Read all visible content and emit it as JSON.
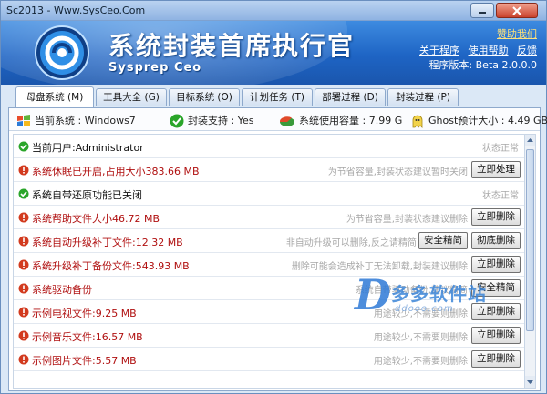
{
  "window": {
    "title": "Sc2013 - Www.SysCeo.Com"
  },
  "header": {
    "app_name": "系统封装首席执行官",
    "app_sub": "Sysprep  Ceo",
    "help_link": "赞助我们",
    "links": [
      "关于程序",
      "使用帮助",
      "反馈"
    ],
    "version": "程序版本: Beta 2.0.0.0"
  },
  "tabs": [
    {
      "label": "母盘系统 (M)"
    },
    {
      "label": "工具大全 (G)"
    },
    {
      "label": "目标系统 (O)"
    },
    {
      "label": "计划任务 (T)"
    },
    {
      "label": "部署过程 (D)"
    },
    {
      "label": "封装过程 (P)"
    }
  ],
  "info": {
    "os": "当前系统 : Windows7",
    "support": "封装支持 : Yes",
    "usage": "系统使用容量 : 7.99 G",
    "ghost": "Ghost预计大小 : 4.49 GB"
  },
  "rows": [
    {
      "status": "ok",
      "label": "当前用户:Administrator",
      "note": "状态正常",
      "buttons": []
    },
    {
      "status": "warn",
      "label": "系统休眠已开启,占用大小383.66 MB",
      "note": "为节省容量,封装状态建议暂时关闭",
      "buttons": [
        "立即处理"
      ]
    },
    {
      "status": "ok",
      "label": "系统自带还原功能已关闭",
      "note": "状态正常",
      "buttons": []
    },
    {
      "status": "warn",
      "label": "系统帮助文件大小46.72 MB",
      "note": "为节省容量,封装状态建议删除",
      "buttons": [
        "立即删除"
      ]
    },
    {
      "status": "warn",
      "label": "系统自动升级补丁文件:12.32 MB",
      "note": "非自动升级可以删除,反之请精简",
      "buttons": [
        "安全精简",
        "彻底删除"
      ]
    },
    {
      "status": "warn",
      "label": "系统升级补丁备份文件:543.93 MB",
      "note": "删除可能会造成补丁无法卸载,封装建议删除",
      "buttons": [
        "立即删除"
      ]
    },
    {
      "status": "warn",
      "label": "系统驱动备份",
      "note": "系统自带驱动备份,建议精简",
      "buttons": [
        "安全精简"
      ]
    },
    {
      "status": "warn",
      "label": "示例电视文件:9.25 MB",
      "note": "用途较少,不需要则删除",
      "buttons": [
        "立即删除"
      ]
    },
    {
      "status": "warn",
      "label": "示例音乐文件:16.57 MB",
      "note": "用途较少,不需要则删除",
      "buttons": [
        "立即删除"
      ]
    },
    {
      "status": "warn",
      "label": "示例图片文件:5.57 MB",
      "note": "用途较少,不需要则删除",
      "buttons": [
        "立即删除"
      ]
    }
  ],
  "watermark": {
    "big": "D",
    "cn": "多多软件站",
    "url": "ddooo.com"
  },
  "colors": {
    "header": "#1e64c4",
    "warn": "#b01010",
    "ok": "#2aa52a",
    "help": "#ffe27a"
  }
}
